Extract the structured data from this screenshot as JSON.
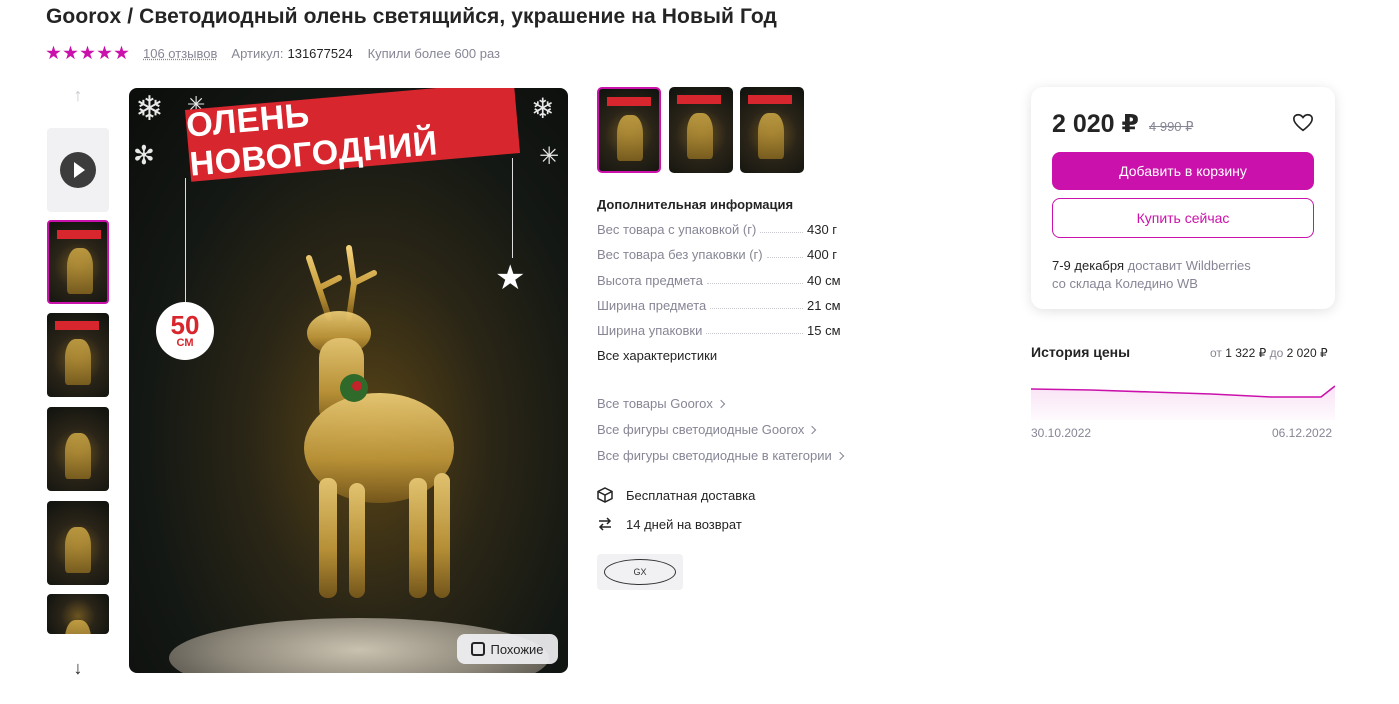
{
  "product": {
    "title": "Goorox / Светодиодный олень светящийся, украшение на Новый Год",
    "reviews": "106 отзывов",
    "article_label": "Артикул:",
    "article_value": "131677524",
    "bought": "Купили более 600 раз",
    "rating": 5
  },
  "image": {
    "banner_text": "ОЛЕНЬ НОВОГОДНИЙ",
    "size_number": "50",
    "size_unit": "СМ",
    "similar_label": "Похожие"
  },
  "info": {
    "title": "Дополнительная информация",
    "specs": [
      {
        "label": "Вес товара с упаковкой (г)",
        "value": "430 г"
      },
      {
        "label": "Вес товара без упаковки (г)",
        "value": "400 г"
      },
      {
        "label": "Высота предмета",
        "value": "40 см"
      },
      {
        "label": "Ширина предмета",
        "value": "21 см"
      },
      {
        "label": "Ширина упаковки",
        "value": "15 см"
      }
    ],
    "all_specs": "Все характеристики",
    "links": [
      "Все товары Goorox",
      "Все фигуры светодиодные Goorox",
      "Все фигуры светодиодные в категории"
    ],
    "features": [
      "Бесплатная доставка",
      "14 дней на возврат"
    ],
    "brand_logo_text": "GX"
  },
  "price_card": {
    "price": "2 020 ₽",
    "old_price": "4 990 ₽",
    "cart_button": "Добавить в корзину",
    "buy_button": "Купить сейчас",
    "delivery_date": "7-9 декабря",
    "delivery_text": " доставит Wildberries",
    "delivery_from": "со склада Коледино WB"
  },
  "price_history": {
    "title": "История цены",
    "from_label": "от",
    "from_value": "1 322 ₽",
    "to_label": "до",
    "to_value": "2 020 ₽",
    "start_date": "30.10.2022",
    "end_date": "06.12.2022"
  },
  "colors": {
    "accent": "#cb11ab",
    "text": "#242424",
    "muted": "#868695",
    "banner_red": "#d7262e"
  },
  "icons": [
    "arrow-up-icon",
    "arrow-down-icon",
    "play-icon",
    "heart-icon",
    "box-icon",
    "return-icon",
    "similar-search-icon",
    "chevron-right-icon",
    "star-icon"
  ]
}
